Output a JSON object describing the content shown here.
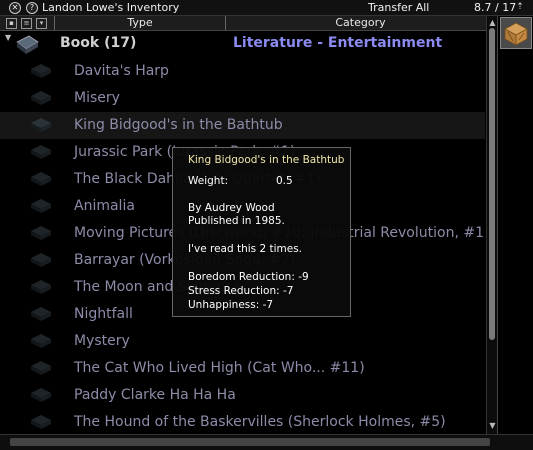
{
  "window": {
    "title": "Landon Lowe's Inventory",
    "transfer_all": "Transfer All",
    "weight": "8.7 / 17"
  },
  "columns": {
    "type": "Type",
    "category": "Category"
  },
  "group": {
    "name": "Book (17)",
    "category": "Literature - Entertainment"
  },
  "items": [
    "Davita's Harp",
    "Misery",
    "King Bidgood's in the Bathtub",
    "Jurassic Park (Jurassic Park, #1)",
    "The Black Dahlia (L.A. Quartet, #1)",
    "Animalia",
    "Moving Pictures (Discworld, #10; Industrial Revolution, #1)",
    "Barrayar (Vorkosigan Saga, #7)",
    "The Moon and Sixpence",
    "Nightfall",
    "Mystery",
    "The Cat Who Lived High (Cat Who... #11)",
    "Paddy Clarke Ha Ha Ha",
    "The Hound of the Baskervilles (Sherlock Holmes, #5)"
  ],
  "tooltip": {
    "title": "King Bidgood's in the Bathtub",
    "weight_label": "Weight:",
    "weight_value": "0.5",
    "author": "By Audrey Wood",
    "published": "Published in 1985.",
    "read_count": "I've read this 2 times.",
    "boredom": "Boredom Reduction: -9",
    "stress": "Stress Reduction: -7",
    "unhappiness": "Unhappiness: -7"
  },
  "icons": {
    "close": "close-icon",
    "info": "info-icon",
    "collapse": "collapse-icon",
    "book": "book-icon",
    "container": "crate-icon"
  },
  "colors": {
    "background": "#000000",
    "item_text": "#8c8ca8",
    "category_text": "#8a8af0",
    "tooltip_title": "#f2e6a8"
  }
}
